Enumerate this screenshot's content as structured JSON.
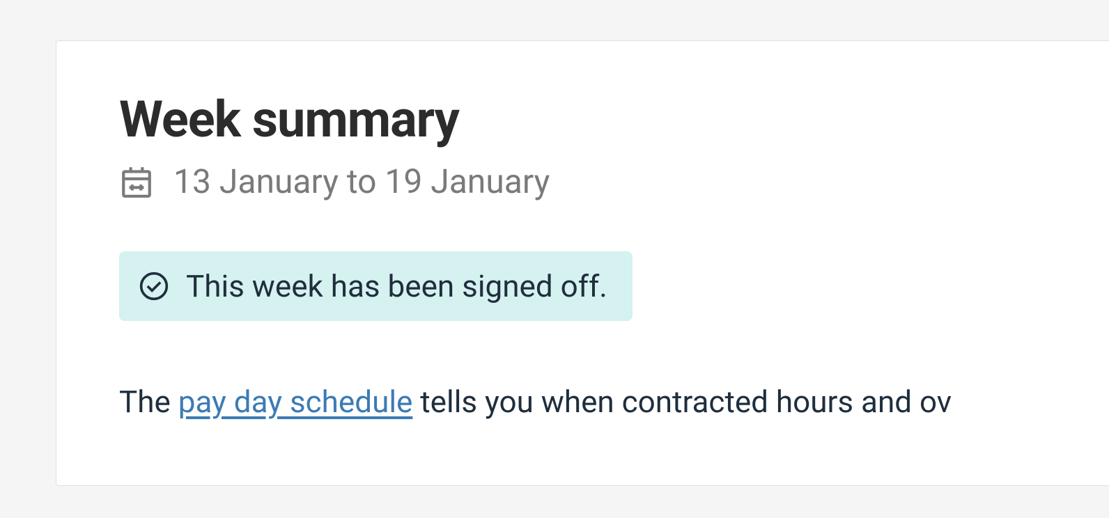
{
  "header": {
    "title": "Week summary",
    "dateRange": "13 January to 19 January"
  },
  "status": {
    "text": "This week has been signed off."
  },
  "description": {
    "prefix": "The ",
    "linkText": "pay day schedule",
    "suffix": " tells you when contracted hours and ov"
  }
}
